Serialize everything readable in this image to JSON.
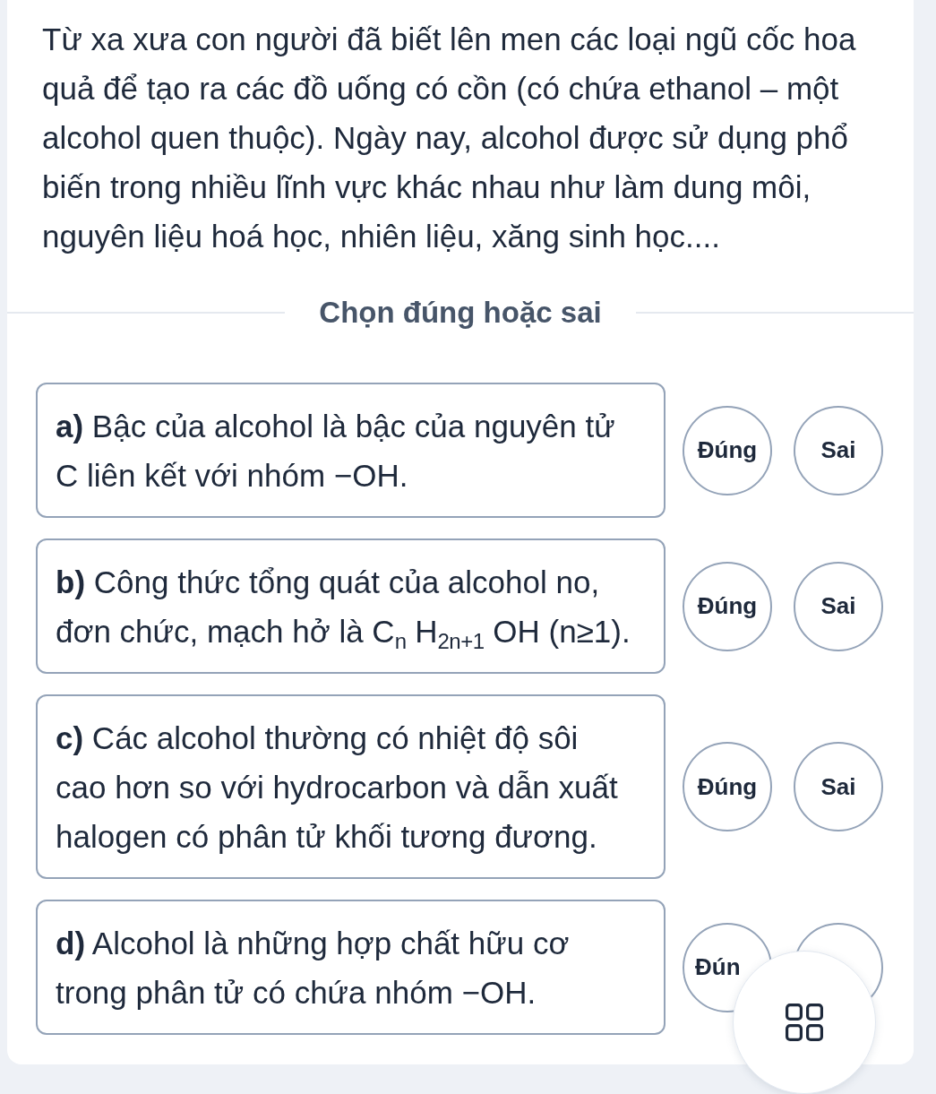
{
  "intro": "Từ xa xưa con người đã biết lên men các loại ngũ cốc hoa quả để tạo ra các đồ uống có cồn (có chứa ethanol – một alcohol quen thuộc). Ngày nay, alcohol được sử dụng phổ biến trong nhiều lĩnh vực khác nhau như làm dung môi, nguyên liệu hoá học, nhiên liệu, xăng sinh học....",
  "section_title": "Chọn đúng hoặc sai",
  "statements": [
    {
      "text": "**a)** Bậc của alcohol là bậc của nguyên tử C liên kết với nhóm −OH.",
      "choices": [
        {
          "label": "Đúng",
          "kind": "full"
        },
        {
          "label": "Sai",
          "kind": "full"
        }
      ]
    },
    {
      "text": "**b)** Công thức tổng quát của alcohol no, đơn chức, mạch hở là C$_{n}$ H$_{2n+1}$ OH (n≥1).",
      "choices": [
        {
          "label": "Đúng",
          "kind": "full"
        },
        {
          "label": "Sai",
          "kind": "full"
        }
      ]
    },
    {
      "text": "**c)** Các alcohol thường có nhiệt độ sôi cao hơn so với hydrocarbon và dẫn xuất halogen có phân tử khối tương đương.",
      "choices": [
        {
          "label": "Đúng",
          "kind": "full"
        },
        {
          "label": "Sai",
          "kind": "full"
        }
      ]
    },
    {
      "text": "**d)** Alcohol là những hợp chất hữu cơ trong phân tử có chứa nhóm −OH.",
      "choices": [
        {
          "label": "Đún",
          "kind": "cut_right"
        },
        {
          "kind": "covered"
        }
      ]
    }
  ]
}
